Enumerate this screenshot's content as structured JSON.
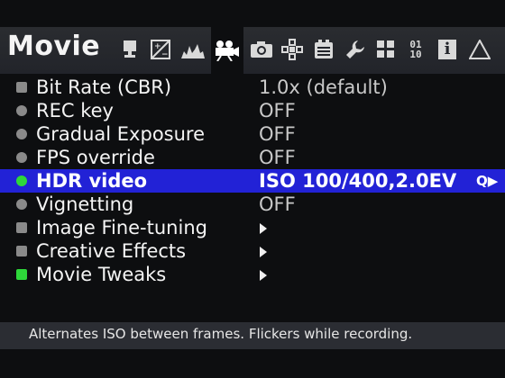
{
  "header": {
    "title": "Movie",
    "tabs": [
      {
        "icon": "monitor-icon",
        "label": ""
      },
      {
        "icon": "exposure-icon",
        "label": ""
      },
      {
        "icon": "histogram-icon",
        "label": ""
      },
      {
        "icon": "movie-camera-icon",
        "label": ""
      },
      {
        "icon": "camera-icon",
        "label": ""
      },
      {
        "icon": "focus-icon",
        "label": ""
      },
      {
        "icon": "card-icon",
        "label": ""
      },
      {
        "icon": "wrench-icon",
        "label": ""
      },
      {
        "icon": "modules-icon",
        "label": ""
      },
      {
        "icon": "debug-icon",
        "label": "01\n10"
      },
      {
        "icon": "info-icon",
        "label": "i"
      },
      {
        "icon": "warning-icon",
        "label": ""
      }
    ]
  },
  "menu": {
    "items": [
      {
        "label": "Bit Rate (CBR)",
        "value": "1.0x (default)",
        "bullet": "square-gray"
      },
      {
        "label": "REC key",
        "value": "OFF",
        "bullet": "circle-gray"
      },
      {
        "label": "Gradual Exposure",
        "value": "OFF",
        "bullet": "circle-gray"
      },
      {
        "label": "FPS override",
        "value": "OFF",
        "bullet": "circle-gray"
      },
      {
        "label": "HDR video",
        "value": "ISO 100/400,2.0EV",
        "bullet": "circle-green",
        "selected": true,
        "extra": "Q▶"
      },
      {
        "label": "Vignetting",
        "value": "OFF",
        "bullet": "circle-gray"
      },
      {
        "label": "Image Fine-tuning",
        "value": "",
        "bullet": "square-gray",
        "submenu": true
      },
      {
        "label": "Creative Effects",
        "value": "",
        "bullet": "square-gray",
        "submenu": true
      },
      {
        "label": "Movie Tweaks",
        "value": "",
        "bullet": "square-green",
        "submenu": true
      }
    ]
  },
  "help": {
    "text": "Alternates ISO between frames. Flickers while recording."
  },
  "colors": {
    "background": "#0d0e10",
    "header": "#2a2c30",
    "selection": "#2222d6",
    "enabled_bullet": "#2ed83a",
    "disabled_bullet": "#8a8a8a",
    "help_bar": "#2b2d33"
  }
}
